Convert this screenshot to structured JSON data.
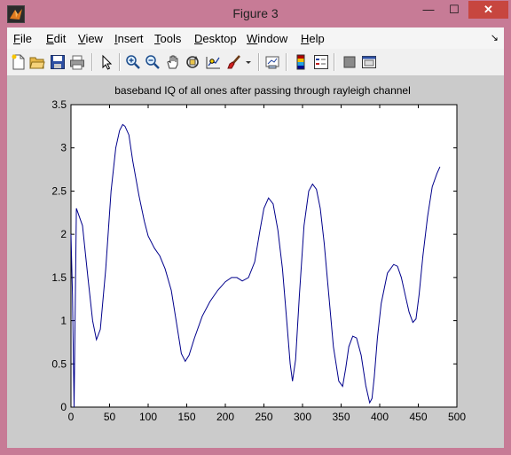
{
  "window": {
    "title": "Figure 3",
    "controls": {
      "minimize": "—",
      "maximize": "☐",
      "close": "✕"
    }
  },
  "menu": [
    {
      "label": "File",
      "accel": "F",
      "rest": "ile"
    },
    {
      "label": "Edit",
      "accel": "E",
      "rest": "dit"
    },
    {
      "label": "View",
      "accel": "V",
      "rest": "iew"
    },
    {
      "label": "Insert",
      "accel": "I",
      "rest": "nsert"
    },
    {
      "label": "Tools",
      "accel": "T",
      "rest": "ools"
    },
    {
      "label": "Desktop",
      "accel": "D",
      "rest": "esktop"
    },
    {
      "label": "Window",
      "accel": "W",
      "rest": "indow"
    },
    {
      "label": "Help",
      "accel": "H",
      "rest": "elp"
    }
  ],
  "toolbar": [
    "new-figure-icon",
    "open-file-icon",
    "save-icon",
    "print-icon",
    "pointer-icon",
    "zoom-in-icon",
    "zoom-out-icon",
    "pan-icon",
    "rotate-3d-icon",
    "data-cursor-icon",
    "brush-icon",
    "link-plot-icon",
    "colorbar-icon",
    "legend-icon",
    "hide-plot-tools-icon",
    "show-plot-tools-icon"
  ],
  "colors": {
    "line": "#00008b",
    "figure_bg": "#cbcbcb",
    "axes_bg": "#ffffff"
  },
  "chart_data": {
    "type": "line",
    "title": "baseband IQ of all ones after passing through rayleigh channel",
    "xlabel": "",
    "ylabel": "",
    "xlim": [
      0,
      500
    ],
    "ylim": [
      0,
      3.5
    ],
    "xticks": [
      "0",
      "50",
      "100",
      "150",
      "200",
      "250",
      "300",
      "350",
      "400",
      "450",
      "500"
    ],
    "yticks": [
      "0",
      "0.5",
      "1",
      "1.5",
      "2",
      "2.5",
      "3",
      "3.5"
    ],
    "grid": false,
    "series": [
      {
        "name": "",
        "x": [
          0,
          2,
          4,
          7,
          15,
          22,
          28,
          33,
          38,
          45,
          52,
          58,
          63,
          67,
          70,
          75,
          80,
          88,
          95,
          100,
          108,
          115,
          122,
          130,
          138,
          143,
          148,
          153,
          160,
          170,
          180,
          190,
          200,
          208,
          215,
          222,
          230,
          238,
          245,
          250,
          256,
          262,
          268,
          274,
          280,
          284,
          287,
          291,
          296,
          302,
          308,
          313,
          318,
          323,
          328,
          334,
          340,
          347,
          352,
          356,
          360,
          365,
          370,
          376,
          382,
          387,
          390,
          393,
          397,
          402,
          410,
          418,
          423,
          428,
          433,
          438,
          443,
          447,
          451,
          456,
          462,
          468,
          474,
          478
        ],
        "y": [
          2.0,
          1.3,
          0.0,
          2.3,
          2.1,
          1.5,
          1.0,
          0.78,
          0.9,
          1.6,
          2.5,
          3.0,
          3.2,
          3.27,
          3.25,
          3.15,
          2.85,
          2.45,
          2.15,
          1.98,
          1.84,
          1.75,
          1.6,
          1.35,
          0.9,
          0.62,
          0.53,
          0.6,
          0.8,
          1.05,
          1.22,
          1.35,
          1.45,
          1.5,
          1.5,
          1.46,
          1.5,
          1.68,
          2.05,
          2.3,
          2.42,
          2.35,
          2.05,
          1.6,
          0.95,
          0.5,
          0.3,
          0.55,
          1.3,
          2.1,
          2.5,
          2.58,
          2.52,
          2.3,
          1.9,
          1.3,
          0.7,
          0.3,
          0.24,
          0.45,
          0.7,
          0.82,
          0.8,
          0.6,
          0.25,
          0.05,
          0.1,
          0.35,
          0.8,
          1.2,
          1.55,
          1.65,
          1.63,
          1.5,
          1.3,
          1.1,
          0.98,
          1.02,
          1.3,
          1.75,
          2.2,
          2.55,
          2.7,
          2.78
        ]
      }
    ]
  }
}
